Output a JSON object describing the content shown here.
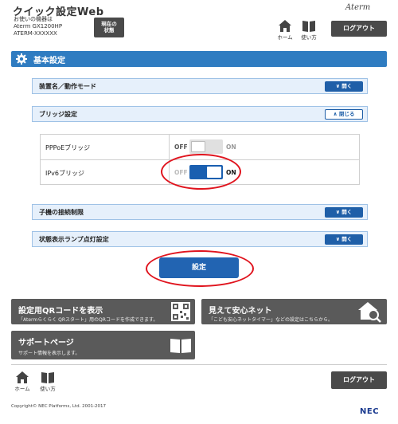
{
  "header": {
    "app_title": "クイック設定Web",
    "model_label": "お使いの機器は",
    "model_name": "Aterm GX1200HP",
    "model_sub": "ATERM-XXXXXX",
    "status_label_line1": "現在の",
    "status_label_line2": "状態",
    "brand": "Aterm",
    "home_label": "ホーム",
    "help_label": "使い方",
    "logout_label": "ログアウト"
  },
  "section": {
    "title": "基本設定"
  },
  "accordions": [
    {
      "title": "装置名／動作モード",
      "button": "開く",
      "state": "closed"
    },
    {
      "title": "ブリッジ設定",
      "button": "閉じる",
      "state": "open"
    },
    {
      "title": "子機の接続制限",
      "button": "開く",
      "state": "closed"
    },
    {
      "title": "状態表示ランプ点灯設定",
      "button": "開く",
      "state": "closed"
    }
  ],
  "bridge_settings": [
    {
      "label": "PPPoEブリッジ",
      "off": "OFF",
      "on": "ON",
      "value": "OFF"
    },
    {
      "label": "IPv6ブリッジ",
      "off": "OFF",
      "on": "ON",
      "value": "ON"
    }
  ],
  "apply_button": "設定",
  "tiles": {
    "qr": {
      "title": "設定用QRコードを表示",
      "sub": "「Atermらくらく QRスタート」用のQRコードを作成できます。"
    },
    "safety": {
      "title": "見えて安心ネット",
      "sub": "「こども安心ネットタイマー」などの設定はこちらから。"
    },
    "support": {
      "title": "サポートページ",
      "sub": "サポート情報を表示します。"
    }
  },
  "footer": {
    "home_label": "ホーム",
    "help_label": "使い方",
    "logout_label": "ログアウト",
    "copyright": "Copyright© NEC Platforms, Ltd. 2001-2017",
    "logo": "NEC"
  },
  "colors": {
    "accent": "#2f7cc1",
    "annotation": "#e0141e",
    "toggle_on": "#1a5fb0"
  }
}
